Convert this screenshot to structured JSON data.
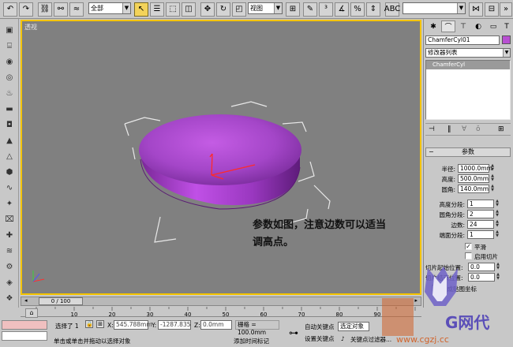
{
  "toolbar": {
    "filter_select": "全部",
    "ref_coord_select": "视图",
    "named_selection": ""
  },
  "viewport": {
    "label": "透视",
    "annotation_line1": "参数如图，注意边数可以适当",
    "annotation_line2": "调高点。"
  },
  "command_panel": {
    "object_name": "ChamferCyl01",
    "object_color": "#b84fd2",
    "modifier_list_label": "修改器列表",
    "stack_item": "ChamferCyl",
    "rollout_title": "参数",
    "params": [
      {
        "label": "半径:",
        "value": "1000.0mm"
      },
      {
        "label": "高度:",
        "value": "500.0mm"
      },
      {
        "label": "圆角:",
        "value": "140.0mm"
      }
    ],
    "segments": [
      {
        "label": "高度分段:",
        "value": "1"
      },
      {
        "label": "圆角分段:",
        "value": "2"
      },
      {
        "label": "边数:",
        "value": "24"
      },
      {
        "label": "端面分段:",
        "value": "1"
      }
    ],
    "smooth_label": "平滑",
    "smooth_checked": true,
    "slice_label": "启用切片",
    "slice_checked": false,
    "slice_from_label": "切片起始位置:",
    "slice_from_value": "0.0",
    "slice_to_label": "切片结束位置:",
    "slice_to_value": "0.0",
    "partial_label": "生成贴图坐标"
  },
  "timeline": {
    "frame_label": "0 / 100",
    "ticks": [
      "0",
      "10",
      "20",
      "30",
      "40",
      "50",
      "60",
      "70",
      "80",
      "90"
    ]
  },
  "status": {
    "selected_label": "选择了 1",
    "x_label": "X:",
    "x_value": "545.788mm",
    "y_label": "Y:",
    "y_value": "-1287.835",
    "z_label": "Z:",
    "z_value": "0.0mm",
    "grid_label": "栅格 = 100.0mm",
    "prompt": "单击或单击并拖动以选择对象",
    "add_time_tag": "添加时间标记",
    "auto_key": "自动关键点",
    "set_key": "设置关键点",
    "selected_objects": "选定对象",
    "key_filters": "关键点过滤器..."
  },
  "watermark": {
    "text": "G网代",
    "url": "www.cgzj.cc"
  }
}
